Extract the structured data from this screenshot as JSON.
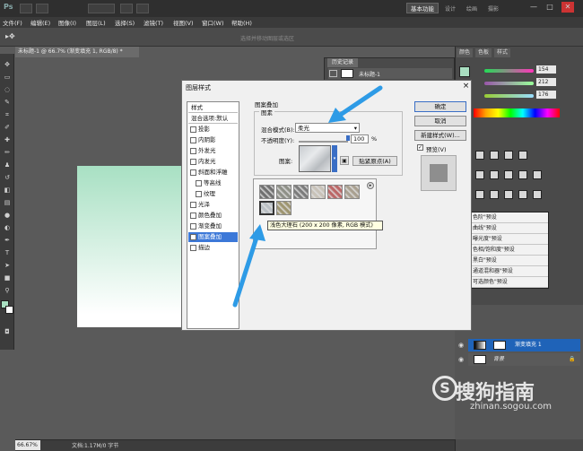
{
  "app": {
    "logo": "Ps",
    "workspace": "基本功能",
    "workspace_links": [
      "设计",
      "绘画",
      "摄影"
    ],
    "window_controls": [
      "—",
      "□",
      "✕"
    ]
  },
  "menu": [
    "文件(F)",
    "编辑(E)",
    "图像(I)",
    "图层(L)",
    "选择(S)",
    "滤镜(T)",
    "视图(V)",
    "窗口(W)",
    "帮助(H)"
  ],
  "options_hint": "选择并移动图层或选区",
  "document": {
    "tab": "未标题-1 @ 66.7% (渐变填充 1, RGB/8) *",
    "zoom": "66.67%",
    "info": "文档:1.17M/0 字节",
    "gradient_top": "#a8e0c3"
  },
  "history": {
    "tab": "历史记录",
    "item": "未标题-1"
  },
  "right_dock": {
    "tabs": [
      "颜色",
      "色板",
      "样式"
    ],
    "sliders": [
      {
        "value": "154",
        "color": "#d44"
      },
      {
        "value": "212",
        "color": "#3b3"
      },
      {
        "value": "176",
        "color": "#46c"
      }
    ],
    "swatch_color": "#a9dfc1",
    "adjustments": [
      "色阶\"预设",
      "曲线\"预设",
      "曝光度\"预设",
      "色相/饱和度\"预设",
      "黑白\"预设",
      "通道混和器\"预设",
      "可选颜色\"预设"
    ],
    "layers": {
      "fill_layer": "渐变填充 1",
      "background": "背景"
    }
  },
  "dialog": {
    "title": "图层样式",
    "style_header": "样式",
    "blend_header": "混合选项:默认",
    "styles": [
      {
        "label": "投影",
        "checked": false,
        "sub": false
      },
      {
        "label": "内阴影",
        "checked": false,
        "sub": false
      },
      {
        "label": "外发光",
        "checked": false,
        "sub": false
      },
      {
        "label": "内发光",
        "checked": false,
        "sub": false
      },
      {
        "label": "斜面和浮雕",
        "checked": false,
        "sub": false
      },
      {
        "label": "等高线",
        "checked": false,
        "sub": true
      },
      {
        "label": "纹理",
        "checked": false,
        "sub": true
      },
      {
        "label": "光泽",
        "checked": false,
        "sub": false
      },
      {
        "label": "颜色叠加",
        "checked": false,
        "sub": false
      },
      {
        "label": "渐变叠加",
        "checked": false,
        "sub": false
      },
      {
        "label": "图案叠加",
        "checked": true,
        "sub": false,
        "selected": true
      },
      {
        "label": "描边",
        "checked": false,
        "sub": false
      }
    ],
    "section_title": "图案叠加",
    "group_label": "图素",
    "blend_mode_label": "混合模式(B):",
    "blend_mode_value": "柔光",
    "opacity_label": "不透明度(Y):",
    "opacity_value": "100",
    "opacity_unit": "%",
    "pattern_label": "图案:",
    "snap_button": "贴紧原点(A)",
    "picker_tooltip": "浅色大理石 (200 x 200 像素, RGB 模式)",
    "swatch_colors": [
      "#6f6f6f",
      "#8d8f86",
      "#7b7b7b",
      "#c8c2b8",
      "#b66",
      "#a9a090",
      "#b9bfc4",
      "#9e9570"
    ],
    "buttons": {
      "ok": "确定",
      "cancel": "取消",
      "new_style": "新建样式(W)...",
      "preview": "预览(V)"
    },
    "preview_checked": "✓"
  },
  "watermark": {
    "logo": "S",
    "cn": "搜狗指南",
    "en": "zhinan.sogou.com"
  }
}
